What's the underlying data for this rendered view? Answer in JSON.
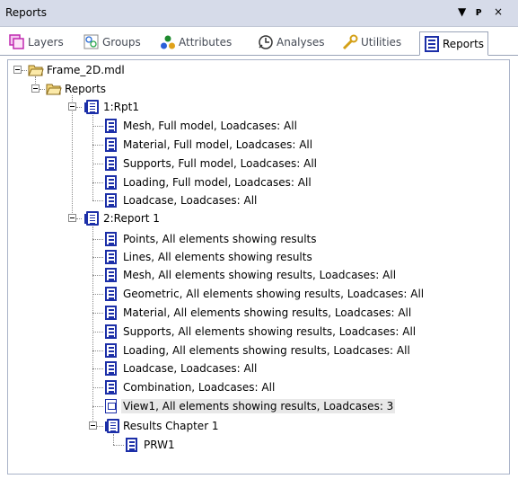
{
  "panel": {
    "title": "Reports",
    "controls": {
      "menu": "▼",
      "pin": "ᵖ",
      "close": "×"
    }
  },
  "tabs": [
    {
      "label": "Layers",
      "icon": "layers-icon"
    },
    {
      "label": "Groups",
      "icon": "groups-icon"
    },
    {
      "label": "Attributes",
      "icon": "attributes-icon"
    },
    {
      "label": "Analyses",
      "icon": "analyses-icon"
    },
    {
      "label": "Utilities",
      "icon": "utilities-icon"
    },
    {
      "label": "Reports",
      "icon": "reports-icon",
      "active": true
    }
  ],
  "tree": {
    "root": "Frame_2D.mdl",
    "reports_folder": "Reports",
    "report1": {
      "label": "1:Rpt1",
      "items": [
        "Mesh, Full model, Loadcases: All",
        "Material, Full model, Loadcases: All",
        "Supports, Full model, Loadcases: All",
        "Loading, Full model, Loadcases: All",
        "Loadcase, Loadcases: All"
      ]
    },
    "report2": {
      "label": "2:Report 1",
      "items": [
        "Points, All elements showing results",
        "Lines, All elements showing results",
        "Mesh, All elements showing results, Loadcases: All",
        "Geometric, All elements showing results, Loadcases: All",
        "Material, All elements showing results, Loadcases: All",
        "Supports, All elements showing results, Loadcases: All",
        "Loading, All elements showing results, Loadcases: All",
        "Loadcase, Loadcases: All",
        "Combination, Loadcases: All",
        "View1, All elements showing results, Loadcases: 3"
      ],
      "chapter": {
        "label": "Results Chapter 1",
        "items": [
          "PRW1"
        ]
      }
    }
  },
  "colors": {
    "titlebar": "#d6dbe9",
    "icon_blue": "#1c2fa8",
    "selected_bg": "#e8e8e8"
  }
}
